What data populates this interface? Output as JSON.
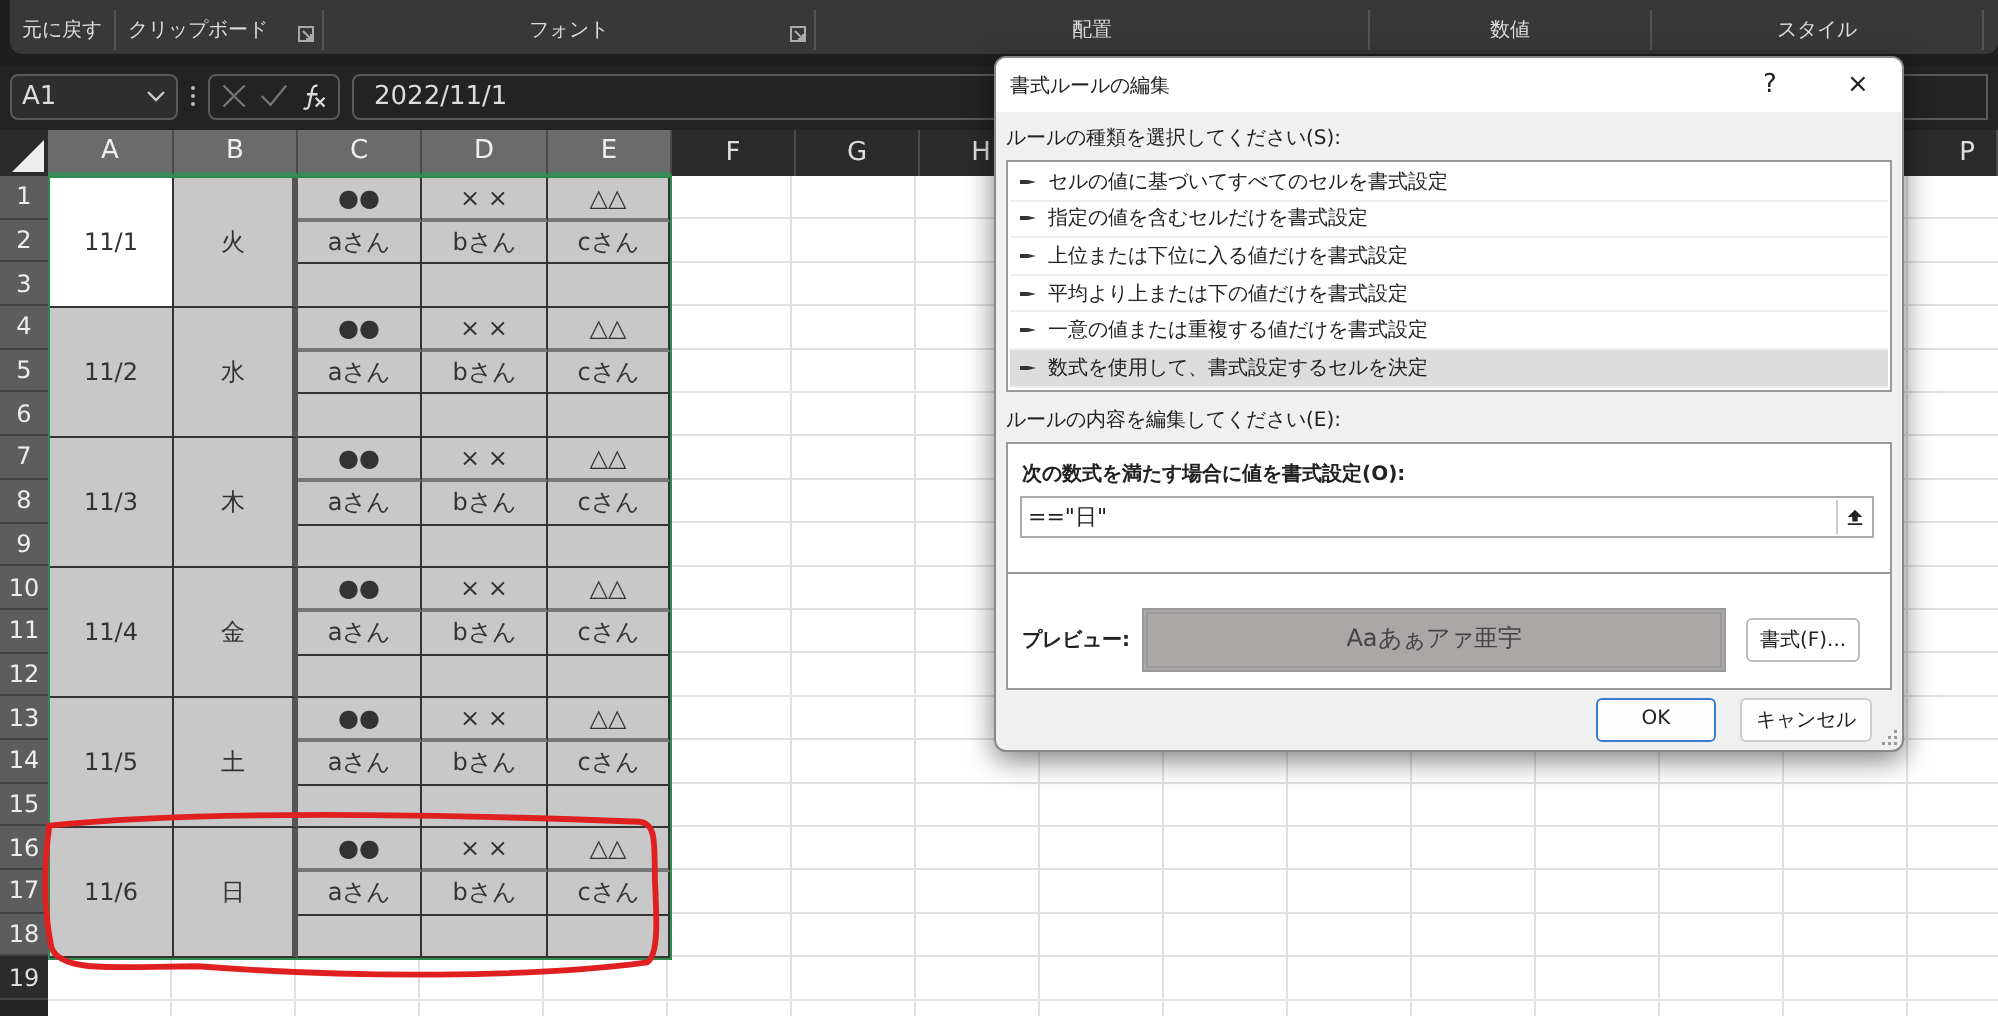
{
  "ribbon": {
    "groups": [
      {
        "label": "元に戻す",
        "launcher": false
      },
      {
        "label": "クリップボード",
        "launcher": true
      },
      {
        "label": "フォント",
        "launcher": true
      },
      {
        "label": "配置",
        "launcher": false
      },
      {
        "label": "数値",
        "launcher": false
      },
      {
        "label": "スタイル",
        "launcher": false
      }
    ]
  },
  "formula_bar": {
    "name_box": "A1",
    "value": "2022/11/1"
  },
  "columns": [
    {
      "label": "A",
      "selected": true
    },
    {
      "label": "B",
      "selected": true
    },
    {
      "label": "C",
      "selected": true
    },
    {
      "label": "D",
      "selected": true
    },
    {
      "label": "E",
      "selected": true
    },
    {
      "label": "F",
      "selected": false
    },
    {
      "label": "G",
      "selected": false
    },
    {
      "label": "H",
      "selected": false
    },
    {
      "label": "P",
      "selected": false
    }
  ],
  "rows": [
    {
      "label": "1",
      "selected": true
    },
    {
      "label": "2",
      "selected": true
    },
    {
      "label": "3",
      "selected": true
    },
    {
      "label": "4",
      "selected": true
    },
    {
      "label": "5",
      "selected": true
    },
    {
      "label": "6",
      "selected": true
    },
    {
      "label": "7",
      "selected": true
    },
    {
      "label": "8",
      "selected": true
    },
    {
      "label": "9",
      "selected": true
    },
    {
      "label": "10",
      "selected": true
    },
    {
      "label": "11",
      "selected": true
    },
    {
      "label": "12",
      "selected": true
    },
    {
      "label": "13",
      "selected": true
    },
    {
      "label": "14",
      "selected": true
    },
    {
      "label": "15",
      "selected": true
    },
    {
      "label": "16",
      "selected": true
    },
    {
      "label": "17",
      "selected": true
    },
    {
      "label": "18",
      "selected": true
    },
    {
      "label": "19",
      "selected": false
    }
  ],
  "days": [
    {
      "date": "11/1",
      "weekday": "火",
      "active": true,
      "highlighted": false,
      "marks": [
        "●●",
        "× ×",
        "△△"
      ],
      "names": [
        "aさん",
        "bさん",
        "cさん"
      ]
    },
    {
      "date": "11/2",
      "weekday": "水",
      "active": false,
      "highlighted": false,
      "marks": [
        "●●",
        "× ×",
        "△△"
      ],
      "names": [
        "aさん",
        "bさん",
        "cさん"
      ]
    },
    {
      "date": "11/3",
      "weekday": "木",
      "active": false,
      "highlighted": false,
      "marks": [
        "●●",
        "× ×",
        "△△"
      ],
      "names": [
        "aさん",
        "bさん",
        "cさん"
      ]
    },
    {
      "date": "11/4",
      "weekday": "金",
      "active": false,
      "highlighted": false,
      "marks": [
        "●●",
        "× ×",
        "△△"
      ],
      "names": [
        "aさん",
        "bさん",
        "cさん"
      ]
    },
    {
      "date": "11/5",
      "weekday": "土",
      "active": false,
      "highlighted": false,
      "marks": [
        "●●",
        "× ×",
        "△△"
      ],
      "names": [
        "aさん",
        "bさん",
        "cさん"
      ]
    },
    {
      "date": "11/6",
      "weekday": "日",
      "active": false,
      "highlighted": true,
      "marks": [
        "●●",
        "× ×",
        "△△"
      ],
      "names": [
        "aさん",
        "bさん",
        "cさん"
      ]
    }
  ],
  "dialog": {
    "title": "書式ルールの編集",
    "help": "?",
    "close": "×",
    "rule_type_label": "ルールの種類を選択してください(S):",
    "rule_types": [
      {
        "label": "セルの値に基づいてすべてのセルを書式設定",
        "selected": false
      },
      {
        "label": "指定の値を含むセルだけを書式設定",
        "selected": false
      },
      {
        "label": "上位または下位に入る値だけを書式設定",
        "selected": false
      },
      {
        "label": "平均より上または下の値だけを書式設定",
        "selected": false
      },
      {
        "label": "一意の値または重複する値だけを書式設定",
        "selected": false
      },
      {
        "label": "数式を使用して、書式設定するセルを決定",
        "selected": true
      }
    ],
    "edit_label": "ルールの内容を編集してください(E):",
    "formula_label": "次の数式を満たす場合に値を書式設定(O):",
    "formula_value": "==\"日\"",
    "preview_label": "プレビュー:",
    "preview_text": "Aaあぁアァ亜宇",
    "format_button": "書式(F)...",
    "buttons": [
      {
        "label": "OK",
        "default": true
      },
      {
        "label": "キャンセル",
        "default": false
      }
    ]
  }
}
